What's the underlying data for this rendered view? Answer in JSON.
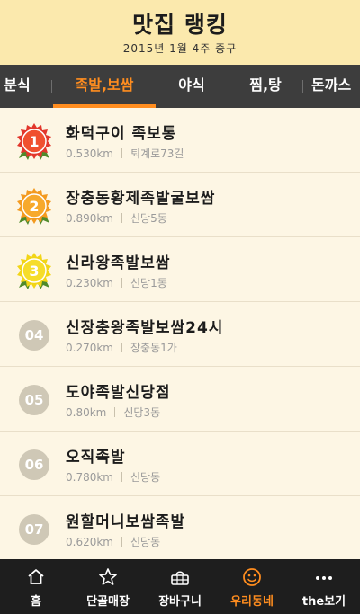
{
  "header": {
    "title": "맛집 랭킹",
    "subtitle": "2015년 1월 4주 중구"
  },
  "tabs": [
    {
      "label": "분식",
      "active": false
    },
    {
      "label": "족발,보쌈",
      "active": true
    },
    {
      "label": "야식",
      "active": false
    },
    {
      "label": "찜,탕",
      "active": false
    },
    {
      "label": "돈까스",
      "active": false
    }
  ],
  "colors": {
    "accent": "#ff8d1f",
    "header_bg": "#fbe9ad",
    "tab_bg": "#3d3d3d",
    "nav_bg": "#1e1e1e",
    "gold": "#f2d516",
    "orange": "#f39a1f",
    "red": "#e2362b",
    "rank_gray": "#cfc8b6"
  },
  "restaurants": [
    {
      "rank": "1",
      "name": "화덕구이 족보통",
      "distance": "0.530km",
      "address": "퇴계로73길",
      "medal": "red-medal-icon"
    },
    {
      "rank": "2",
      "name": "장충동황제족발굴보쌈",
      "distance": "0.890km",
      "address": "신당5동",
      "medal": "orange-medal-icon"
    },
    {
      "rank": "3",
      "name": "신라왕족발보쌈",
      "distance": "0.230km",
      "address": "신당1동",
      "medal": "gold-medal-icon"
    },
    {
      "rank": "04",
      "name": "신장충왕족발보쌈24시",
      "distance": "0.270km",
      "address": "장충동1가"
    },
    {
      "rank": "05",
      "name": "도야족발신당점",
      "distance": "0.80km",
      "address": "신당3동"
    },
    {
      "rank": "06",
      "name": "오직족발",
      "distance": "0.780km",
      "address": "신당동"
    },
    {
      "rank": "07",
      "name": "원할머니보쌈족발",
      "distance": "0.620km",
      "address": "신당동"
    }
  ],
  "bottom_nav": [
    {
      "label": "홈",
      "icon": "home-icon",
      "active": false
    },
    {
      "label": "단골매장",
      "icon": "star-icon",
      "active": false
    },
    {
      "label": "장바구니",
      "icon": "basket-icon",
      "active": false
    },
    {
      "label": "우리동네",
      "icon": "neighborhood-icon",
      "active": true
    },
    {
      "label": "the보기",
      "icon": "more-icon",
      "active": false
    }
  ]
}
